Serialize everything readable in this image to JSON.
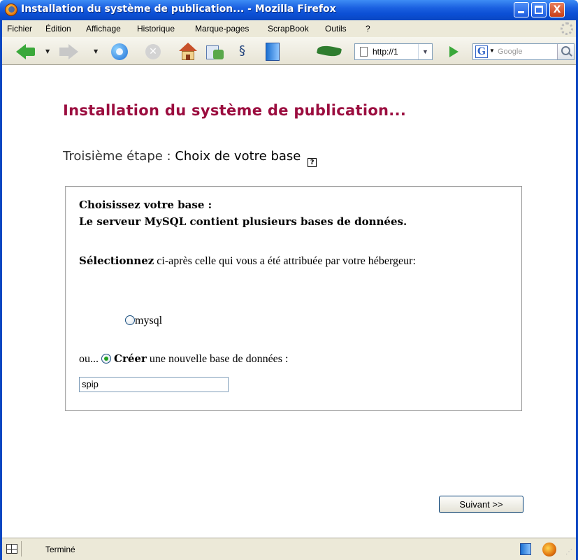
{
  "window": {
    "title": "Installation du système de publication... - Mozilla Firefox",
    "minimize_label": "_",
    "close_label": "X"
  },
  "menubar": {
    "items": [
      "Fichier",
      "Édition",
      "Affichage",
      "Historique",
      "Marque-pages",
      "ScrapBook",
      "Outils",
      "?"
    ]
  },
  "toolbar": {
    "url": "http://1",
    "search_placeholder": "Google",
    "search_engine_letter": "G"
  },
  "page": {
    "title": "Installation du système de publication...",
    "step_label": "Troisième étape : ",
    "step_name": "Choix de votre base",
    "help_label": "?",
    "panel": {
      "heading_line1": "Choisissez votre base :",
      "heading_line2": "Le serveur MySQL contient plusieurs bases de données.",
      "select_strong": "Sélectionnez",
      "select_rest": " ci-après celle qui vous a été attribuée par votre hébergeur:",
      "option_mysql": "mysql",
      "or_label": "ou... ",
      "create_strong": "Créer",
      "create_rest": " une nouvelle base de données :",
      "new_db_value": "spip"
    },
    "next_button": "Suivant >>"
  },
  "statusbar": {
    "text": "Terminé"
  },
  "colors": {
    "title_color": "#9b0d3f",
    "titlebar_blue": "#0b4fd4",
    "radio_checked": "#21a121"
  }
}
